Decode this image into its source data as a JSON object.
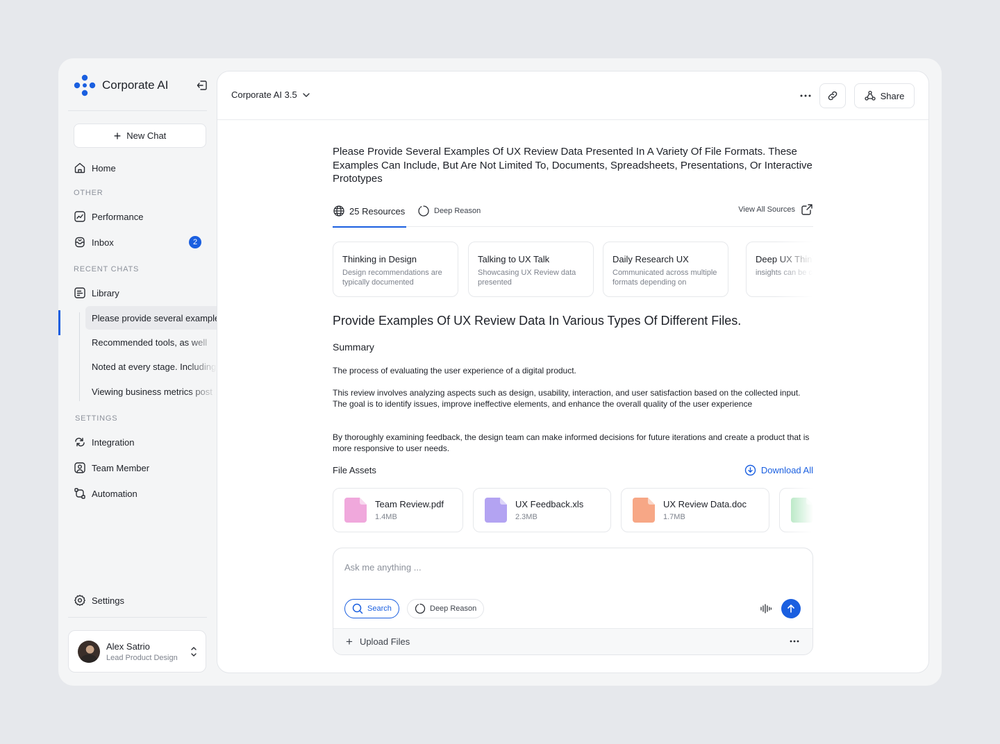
{
  "app": {
    "name": "Corporate AI"
  },
  "sidebar": {
    "new_chat": "New Chat",
    "home": "Home",
    "other_label": "OTHER",
    "performance": "Performance",
    "inbox": "Inbox",
    "inbox_badge": "2",
    "recent_label": "RECENT CHATS",
    "library": "Library",
    "chats": [
      "Please provide several examples",
      "Recommended tools, as well",
      "Noted at every stage. Including",
      "Viewing business metrics post"
    ],
    "settings_label": "SETTINGS",
    "integration": "Integration",
    "team_member": "Team Member",
    "automation": "Automation",
    "settings": "Settings"
  },
  "user": {
    "name": "Alex Satrio",
    "role": "Lead Product Design"
  },
  "header": {
    "model": "Corporate AI 3.5",
    "share": "Share"
  },
  "conversation": {
    "prompt": "Please Provide Several Examples Of UX Review Data Presented In A Variety Of File Formats. These Examples Can Include, But Are Not Limited To, Documents, Spreadsheets, Presentations, Or Interactive Prototypes",
    "tab_resources": "25 Resources",
    "tab_deep": "Deep Reason",
    "view_all": "View All Sources",
    "sources": [
      {
        "title": "Thinking in Design",
        "desc": "Design recommendations are typically documented"
      },
      {
        "title": "Talking to UX Talk",
        "desc": "Showcasing UX Review data presented"
      },
      {
        "title": "Daily Research UX",
        "desc": "Communicated across multiple formats depending on"
      },
      {
        "title": "Deep UX Thinking",
        "desc": "insights can be communicated"
      }
    ],
    "answer_title": "Provide Examples Of UX Review Data In Various Types Of Different Files.",
    "summary_heading": "Summary",
    "paragraphs": [
      "The process of evaluating the user experience of a digital product.",
      "This review involves analyzing aspects such as design, usability, interaction, and user satisfaction based on the collected input. The goal is to identify issues, improve ineffective elements, and enhance the overall quality of the user experience",
      "By thoroughly examining feedback, the design team can make informed decisions for future iterations and create a product that is more responsive to user needs."
    ],
    "assets_heading": "File Assets",
    "download_all": "Download All",
    "files": [
      {
        "name": "Team Review.pdf",
        "size": "1.4MB",
        "color": "#f0a8dc"
      },
      {
        "name": "UX Feedback.xls",
        "size": "2.3MB",
        "color": "#b3a3f2"
      },
      {
        "name": "UX Review Data.doc",
        "size": "1.7MB",
        "color": "#f7a786"
      },
      {
        "name": "",
        "size": "",
        "color": "#a8e3b8"
      }
    ]
  },
  "composer": {
    "placeholder": "Ask me anything ...",
    "search": "Search",
    "deep": "Deep Reason",
    "upload": "Upload Files"
  },
  "colors": {
    "accent": "#1a5fe0"
  }
}
